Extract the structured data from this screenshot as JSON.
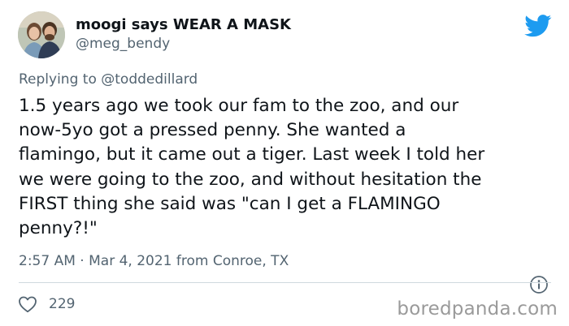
{
  "author": {
    "display_name": "moogi says WEAR A MASK",
    "handle": "@meg_bendy",
    "avatar_icon": "avatar-photo"
  },
  "reply": {
    "prefix": "Replying to",
    "mention": "@toddedillard"
  },
  "tweet": {
    "text": "1.5 years ago we took our fam to the zoo, and our\nnow-5yo got a pressed penny. She wanted a\nflamingo, but it came out a tiger. Last week I told her\nwe were going to the zoo, and without hesitation the\nFIRST thing she said was \"can I get a FLAMINGO\npenny?!\""
  },
  "meta": {
    "time": "2:57 AM",
    "separator": "·",
    "date": "Mar 4, 2021",
    "location": "from Conroe, TX"
  },
  "engagement": {
    "like_count": "229"
  },
  "watermark": "boredpanda.com",
  "colors": {
    "twitter_blue": "#1d9bf0",
    "muted_text": "#536471",
    "divider": "#cfd9de"
  },
  "icons": {
    "brand": "twitter-bird-icon",
    "info": "info-icon",
    "like": "heart-icon"
  }
}
